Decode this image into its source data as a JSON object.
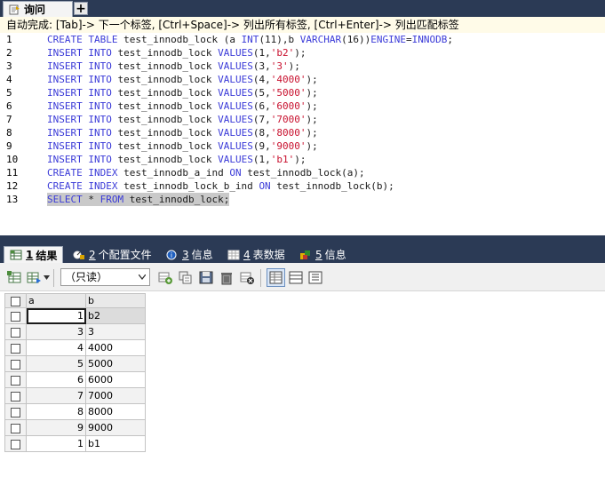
{
  "tabs": {
    "query_label": "询问",
    "add_label": "+"
  },
  "hint": "自动完成: [Tab]-> 下一个标签, [Ctrl+Space]-> 列出所有标签, [Ctrl+Enter]-> 列出匹配标签",
  "editor": {
    "lines": [
      {
        "n": "1",
        "tokens": [
          [
            "kw",
            "CREATE TABLE"
          ],
          [
            "id",
            " test_innodb_lock (a "
          ],
          [
            "kw",
            "INT"
          ],
          [
            "id",
            "(11),b "
          ],
          [
            "kw",
            "VARCHAR"
          ],
          [
            "id",
            "(16))"
          ],
          [
            "kw",
            "ENGINE"
          ],
          [
            "id",
            "="
          ],
          [
            "kw",
            "INNODB"
          ],
          [
            "id",
            ";"
          ]
        ]
      },
      {
        "n": "2",
        "tokens": [
          [
            "kw",
            "INSERT INTO"
          ],
          [
            "id",
            " test_innodb_lock "
          ],
          [
            "kw",
            "VALUES"
          ],
          [
            "id",
            "(1,"
          ],
          [
            "str",
            "'b2'"
          ],
          [
            "id",
            ");"
          ]
        ]
      },
      {
        "n": "3",
        "tokens": [
          [
            "kw",
            "INSERT INTO"
          ],
          [
            "id",
            " test_innodb_lock "
          ],
          [
            "kw",
            "VALUES"
          ],
          [
            "id",
            "(3,"
          ],
          [
            "str",
            "'3'"
          ],
          [
            "id",
            ");"
          ]
        ]
      },
      {
        "n": "4",
        "tokens": [
          [
            "kw",
            "INSERT INTO"
          ],
          [
            "id",
            " test_innodb_lock "
          ],
          [
            "kw",
            "VALUES"
          ],
          [
            "id",
            "(4,"
          ],
          [
            "str",
            "'4000'"
          ],
          [
            "id",
            ");"
          ]
        ]
      },
      {
        "n": "5",
        "tokens": [
          [
            "kw",
            "INSERT INTO"
          ],
          [
            "id",
            " test_innodb_lock "
          ],
          [
            "kw",
            "VALUES"
          ],
          [
            "id",
            "(5,"
          ],
          [
            "str",
            "'5000'"
          ],
          [
            "id",
            ");"
          ]
        ]
      },
      {
        "n": "6",
        "tokens": [
          [
            "kw",
            "INSERT INTO"
          ],
          [
            "id",
            " test_innodb_lock "
          ],
          [
            "kw",
            "VALUES"
          ],
          [
            "id",
            "(6,"
          ],
          [
            "str",
            "'6000'"
          ],
          [
            "id",
            ");"
          ]
        ]
      },
      {
        "n": "7",
        "tokens": [
          [
            "kw",
            "INSERT INTO"
          ],
          [
            "id",
            " test_innodb_lock "
          ],
          [
            "kw",
            "VALUES"
          ],
          [
            "id",
            "(7,"
          ],
          [
            "str",
            "'7000'"
          ],
          [
            "id",
            ");"
          ]
        ]
      },
      {
        "n": "8",
        "tokens": [
          [
            "kw",
            "INSERT INTO"
          ],
          [
            "id",
            " test_innodb_lock "
          ],
          [
            "kw",
            "VALUES"
          ],
          [
            "id",
            "(8,"
          ],
          [
            "str",
            "'8000'"
          ],
          [
            "id",
            ");"
          ]
        ]
      },
      {
        "n": "9",
        "tokens": [
          [
            "kw",
            "INSERT INTO"
          ],
          [
            "id",
            " test_innodb_lock "
          ],
          [
            "kw",
            "VALUES"
          ],
          [
            "id",
            "(9,"
          ],
          [
            "str",
            "'9000'"
          ],
          [
            "id",
            ");"
          ]
        ]
      },
      {
        "n": "10",
        "tokens": [
          [
            "kw",
            "INSERT INTO"
          ],
          [
            "id",
            " test_innodb_lock "
          ],
          [
            "kw",
            "VALUES"
          ],
          [
            "id",
            "(1,"
          ],
          [
            "str",
            "'b1'"
          ],
          [
            "id",
            ");"
          ]
        ]
      },
      {
        "n": "11",
        "tokens": [
          [
            "kw",
            "CREATE INDEX"
          ],
          [
            "id",
            " test_innodb_a_ind "
          ],
          [
            "kw",
            "ON"
          ],
          [
            "id",
            " test_innodb_lock(a);"
          ]
        ]
      },
      {
        "n": "12",
        "tokens": [
          [
            "kw",
            "CREATE INDEX"
          ],
          [
            "id",
            " test_innodb_lock_b_ind "
          ],
          [
            "kw",
            "ON"
          ],
          [
            "id",
            " test_innodb_lock(b);"
          ]
        ]
      },
      {
        "n": "13",
        "selected": true,
        "tokens": [
          [
            "kw",
            "SELECT"
          ],
          [
            "id",
            " * "
          ],
          [
            "kw",
            "FROM"
          ],
          [
            "id",
            " test_innodb_lock;"
          ]
        ]
      }
    ]
  },
  "result_tabs": [
    {
      "num": "1",
      "label": "结果",
      "icon": "result-grid-icon",
      "active": true
    },
    {
      "num": "2",
      "label": "个配置文件",
      "icon": "profile-icon",
      "active": false
    },
    {
      "num": "3",
      "label": "信息",
      "icon": "info-icon",
      "active": false
    },
    {
      "num": "4",
      "label": "表数据",
      "icon": "table-data-icon",
      "active": false
    },
    {
      "num": "5",
      "label": "信息",
      "icon": "info-history-icon",
      "active": false
    }
  ],
  "toolbar": {
    "mode_select": "（只读）"
  },
  "grid": {
    "columns": [
      "a",
      "b"
    ],
    "rows": [
      [
        "1",
        "b2"
      ],
      [
        "3",
        "3"
      ],
      [
        "4",
        "4000"
      ],
      [
        "5",
        "5000"
      ],
      [
        "6",
        "6000"
      ],
      [
        "7",
        "7000"
      ],
      [
        "8",
        "8000"
      ],
      [
        "9",
        "9000"
      ],
      [
        "1",
        "b1"
      ]
    ]
  },
  "colors": {
    "keyword": "#3b3bd8",
    "string": "#c8102e",
    "chrome": "#2b3a55",
    "hint_bg": "#fffbe8"
  }
}
